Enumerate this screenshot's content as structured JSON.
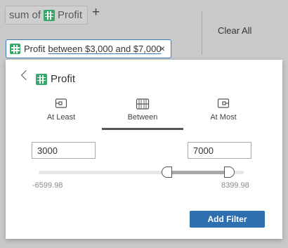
{
  "shelf": {
    "measure_prefix": "sum of",
    "measure_field": "Profit",
    "add_label": "+",
    "clear_all_label": "Clear All"
  },
  "chip": {
    "field": "Profit",
    "condition": "between $3,000 and $7,000",
    "remove_label": "×"
  },
  "panel": {
    "back_icon": "chevron-left-icon",
    "field": "Profit",
    "modes": [
      {
        "label": "At Least",
        "icon": "at-least-icon",
        "active": false
      },
      {
        "label": "Between",
        "icon": "between-icon",
        "active": true
      },
      {
        "label": "At Most",
        "icon": "at-most-icon",
        "active": false
      }
    ],
    "min_value": "3000",
    "max_value": "7000",
    "range_min_label": "-6599.98",
    "range_max_label": "8399.98",
    "slider": {
      "range_min": -6599.98,
      "range_max": 8399.98,
      "low": 3000,
      "high": 7000
    },
    "add_filter_label": "Add Filter"
  },
  "colors": {
    "accent": "#2e6fb0",
    "field_icon": "#37a86a",
    "chip_border": "#3c7bbf"
  }
}
